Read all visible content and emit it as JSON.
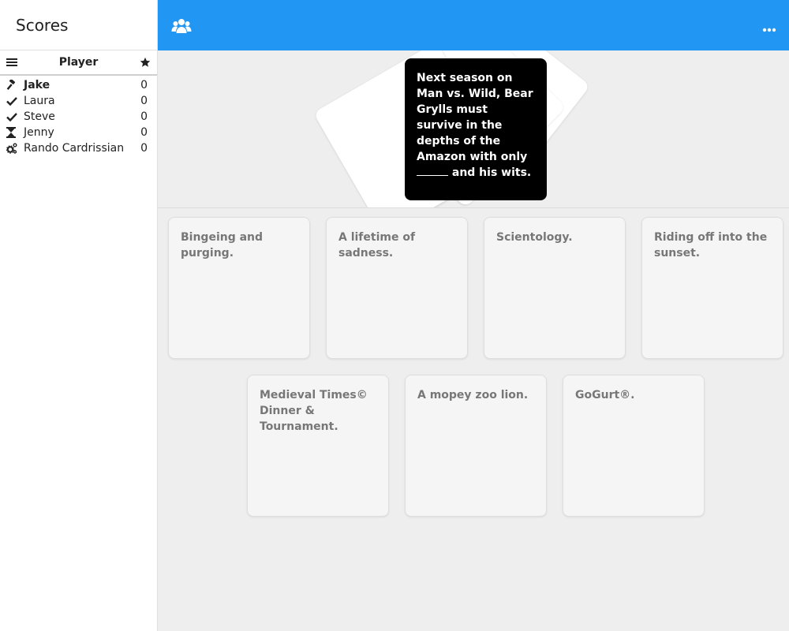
{
  "sidebar": {
    "title": "Scores",
    "header": {
      "player_label": "Player"
    },
    "players": [
      {
        "name": "Jake",
        "score": "0",
        "status": "gavel-icon",
        "bold": true
      },
      {
        "name": "Laura",
        "score": "0",
        "status": "check-icon"
      },
      {
        "name": "Steve",
        "score": "0",
        "status": "check-icon"
      },
      {
        "name": "Jenny",
        "score": "0",
        "status": "hourglass-icon"
      },
      {
        "name": "Rando Cardrissian",
        "score": "0",
        "status": "cogs-icon"
      }
    ]
  },
  "topbar": {
    "color": "#2196f3"
  },
  "black_card": {
    "text_before": "Next season on Man vs. Wild, Bear Grylls must survive in the depths of the Amazon with only ",
    "text_after": " and his wits."
  },
  "white_cards": [
    "Bingeing and purging.",
    "A lifetime of sadness.",
    "Scientology.",
    "Riding off into the sunset.",
    "Medieval Times© Dinner & Tournament.",
    "A mopey zoo lion.",
    "GoGurt®."
  ]
}
